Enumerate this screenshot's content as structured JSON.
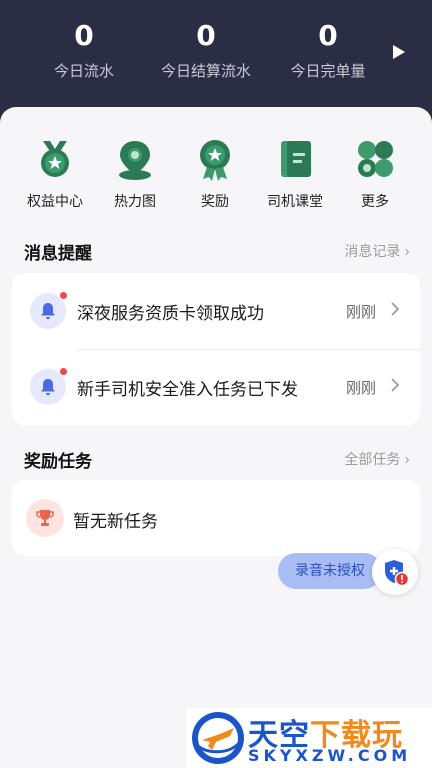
{
  "header": {
    "stats": [
      {
        "value": "0",
        "label": "今日流水"
      },
      {
        "value": "0",
        "label": "今日结算流水"
      },
      {
        "value": "0",
        "label": "今日完单量"
      }
    ]
  },
  "quick_actions": [
    {
      "label": "权益中心",
      "icon": "badge-icon"
    },
    {
      "label": "热力图",
      "icon": "map-pin-icon"
    },
    {
      "label": "奖励",
      "icon": "medal-icon"
    },
    {
      "label": "司机课堂",
      "icon": "book-icon"
    },
    {
      "label": "更多",
      "icon": "grid-icon"
    }
  ],
  "messages": {
    "title": "消息提醒",
    "link": "消息记录",
    "items": [
      {
        "text": "深夜服务资质卡领取成功",
        "time": "刚刚"
      },
      {
        "text": "新手司机安全准入任务已下发",
        "time": "刚刚"
      }
    ]
  },
  "tasks": {
    "title": "奖励任务",
    "link": "全部任务",
    "empty_text": "暂无新任务"
  },
  "recording": {
    "label": "录音未授权"
  },
  "watermark": {
    "big_blue": "天空",
    "big_orange": "下载玩",
    "small": "SKYXZW.COM"
  },
  "colors": {
    "header_bg": "#2b2d44",
    "icon_green": "#2c7a55",
    "accent_blue": "#2a4fc2",
    "alert_red": "#f2454f"
  }
}
